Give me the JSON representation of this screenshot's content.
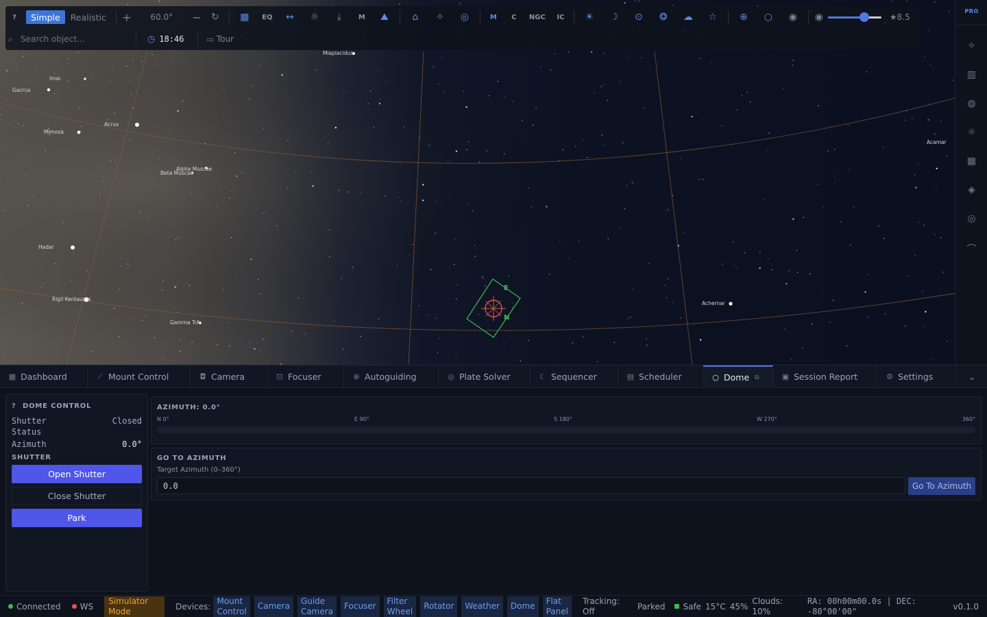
{
  "toolbar": {
    "help_label": "?",
    "mode_simple": "Simple",
    "mode_realistic": "Realistic",
    "fov_value": "60.0°",
    "txt_eq": "EQ",
    "txt_m": "M",
    "txt_m2": "M",
    "txt_c": "C",
    "txt_ngc": "NGC",
    "txt_ic": "IC",
    "mag_value": "★8.5",
    "mag_slider_fraction": 0.72,
    "search_placeholder": "Search object...",
    "time_value": "18:46",
    "tour_label": "Tour"
  },
  "sidebar": {
    "pro_label": "PRO"
  },
  "sky": {
    "stars": [
      {
        "name": "Miaplacidus",
        "label": "Miaplacidus"
      },
      {
        "name": "Imai",
        "label": "Imai"
      },
      {
        "name": "Gacrux",
        "label": "Gacrux"
      },
      {
        "name": "Acrux",
        "label": "Acrux"
      },
      {
        "name": "Mimosa",
        "label": "Mimosa"
      },
      {
        "name": "Alpha Muscae",
        "label": "Alpha Muscae"
      },
      {
        "name": "Beta Muscae",
        "label": "Beta Muscae"
      },
      {
        "name": "Hadar",
        "label": "Hadar"
      },
      {
        "name": "Rigil Kentaurus",
        "label": "Rigil Kentaurus"
      },
      {
        "name": "Gamma TrA",
        "label": "Gamma TrA"
      },
      {
        "name": "Achernar",
        "label": "Achernar"
      },
      {
        "name": "Acamar",
        "label": "Acamar"
      }
    ],
    "fov_label_e": "E",
    "fov_label_n": "N"
  },
  "tabs": [
    {
      "label": "Dashboard",
      "icon": "grid-icon"
    },
    {
      "label": "Mount Control",
      "icon": "telescope-icon"
    },
    {
      "label": "Camera",
      "icon": "camera-icon"
    },
    {
      "label": "Focuser",
      "icon": "focus-icon"
    },
    {
      "label": "Autoguiding",
      "icon": "crosshair-icon"
    },
    {
      "label": "Plate Solver",
      "icon": "compass-icon"
    },
    {
      "label": "Sequencer",
      "icon": "moon-icon"
    },
    {
      "label": "Scheduler",
      "icon": "calendar-icon"
    },
    {
      "label": "Dome",
      "icon": "circle-icon"
    },
    {
      "label": "Session Report",
      "icon": "clipboard-icon"
    },
    {
      "label": "Settings",
      "icon": "gear-icon"
    }
  ],
  "dome": {
    "help_label": "?",
    "title": "DOME CONTROL",
    "shutter_status_label": "Shutter Status",
    "shutter_status_value": "Closed",
    "azimuth_label": "Azimuth",
    "azimuth_value": "0.0°",
    "shutter_heading": "SHUTTER",
    "open_shutter": "Open Shutter",
    "close_shutter": "Close Shutter",
    "park": "Park"
  },
  "azimuth": {
    "title": "AZIMUTH: 0.0°",
    "ticks": [
      "N 0°",
      "E 90°",
      "S 180°",
      "W 270°",
      "360°"
    ]
  },
  "goto": {
    "title": "GO TO AZIMUTH",
    "label": "Target Azimuth (0–360°)",
    "value": "0.0",
    "button": "Go To Azimuth"
  },
  "status": {
    "connected": "Connected",
    "ws": "WS",
    "simulator_line1": "Simulator",
    "simulator_line2": "Mode",
    "devices_label": "Devices:",
    "devices": [
      {
        "l1": "Mount",
        "l2": "Control"
      },
      {
        "l1": "Camera",
        "l2": ""
      },
      {
        "l1": "Guide",
        "l2": "Camera"
      },
      {
        "l1": "Focuser",
        "l2": ""
      },
      {
        "l1": "Filter",
        "l2": "Wheel"
      },
      {
        "l1": "Rotator",
        "l2": ""
      },
      {
        "l1": "Weather",
        "l2": ""
      },
      {
        "l1": "Dome",
        "l2": ""
      },
      {
        "l1": "Flat",
        "l2": "Panel"
      }
    ],
    "tracking_l1": "Tracking:",
    "tracking_l2": "Off",
    "parked": "Parked",
    "safe": "Safe",
    "temp": "15°C",
    "humidity": "45%",
    "clouds_l1": "Clouds:",
    "clouds_l2": "10%",
    "coords_l1": "RA: 00h00m00.0s | DEC:",
    "coords_l2": "-80°00'00\"",
    "version": "v0.1.0"
  },
  "colors": {
    "accent": "#4f56e8",
    "link": "#5b8be6",
    "connected": "#3fb950",
    "ws": "#e5534b",
    "simulator_bg": "#4a3310",
    "simulator_fg": "#f0a030"
  }
}
